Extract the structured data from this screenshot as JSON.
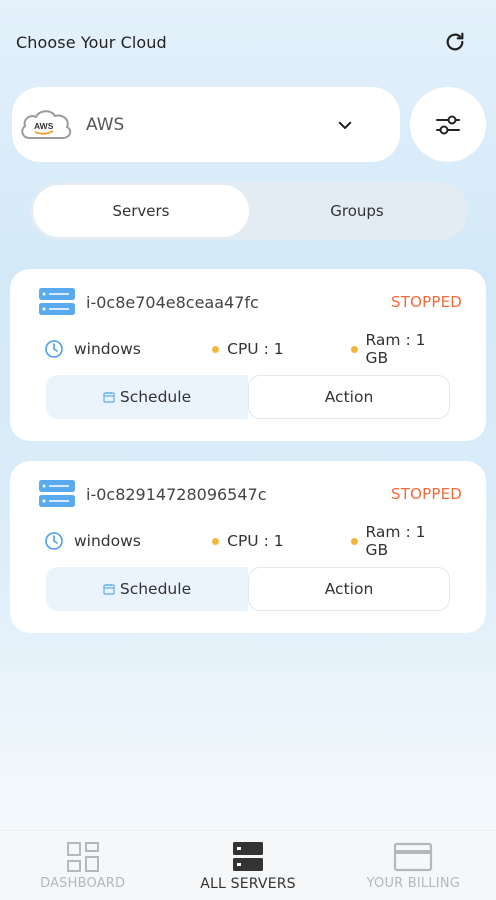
{
  "header": {
    "title": "Choose Your Cloud"
  },
  "cloud_select": {
    "logo_text": "AWS",
    "selected": "AWS"
  },
  "tabs": [
    {
      "label": "Servers",
      "active": true
    },
    {
      "label": "Groups",
      "active": false
    }
  ],
  "servers": [
    {
      "id": "i-0c8e704e8ceaa47fc",
      "status": "STOPPED",
      "os": "windows",
      "cpu": "CPU : 1",
      "ram": "Ram : 1 GB",
      "schedule_label": "Schedule",
      "action_label": "Action"
    },
    {
      "id": "i-0c82914728096547c",
      "status": "STOPPED",
      "os": "windows",
      "cpu": "CPU : 1",
      "ram": "Ram : 1 GB",
      "schedule_label": "Schedule",
      "action_label": "Action"
    }
  ],
  "bottom_nav": [
    {
      "label": "DASHBOARD",
      "icon": "grid-icon",
      "active": false
    },
    {
      "label": "ALL SERVERS",
      "icon": "servers-icon",
      "active": true
    },
    {
      "label": "YOUR BILLING",
      "icon": "credit-card-icon",
      "active": false
    }
  ],
  "colors": {
    "status_stopped": "#f26b3a",
    "spec_dot": "#f2b63c",
    "server_icon": "#5aaaf0",
    "clock_icon": "#4a9be8"
  }
}
